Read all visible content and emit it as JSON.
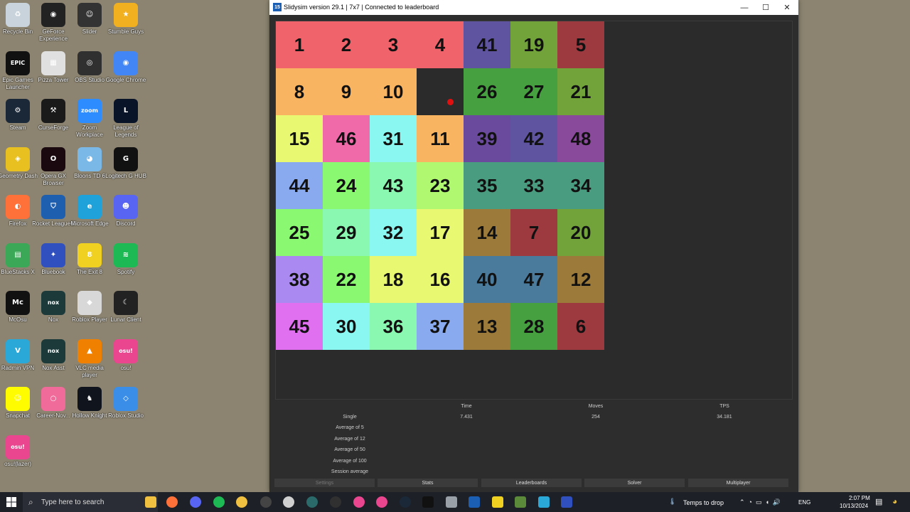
{
  "desktop": {
    "icons": [
      {
        "label": "Recycle Bin",
        "icon": "recycle-bin-icon",
        "color": "#c8d3dc",
        "glyph": "♻"
      },
      {
        "label": "GeForce Experience",
        "icon": "geforce-icon",
        "color": "#222222",
        "glyph": "◉"
      },
      {
        "label": "Slider",
        "icon": "slider-icon",
        "color": "#333333",
        "glyph": "☺"
      },
      {
        "label": "Stumble Guys",
        "icon": "stumble-guys-icon",
        "color": "#f0b020",
        "glyph": "★"
      },
      {
        "label": "Epic Games Launcher",
        "icon": "epic-games-icon",
        "color": "#111111",
        "glyph": "EPIC"
      },
      {
        "label": "Pizza Tower",
        "icon": "pizza-tower-icon",
        "color": "#e0e0e0",
        "glyph": "▦"
      },
      {
        "label": "OBS Studio",
        "icon": "obs-icon",
        "color": "#303030",
        "glyph": "◎"
      },
      {
        "label": "Google Chrome",
        "icon": "chrome-icon",
        "color": "#4285f4",
        "glyph": "◉"
      },
      {
        "label": "Steam",
        "icon": "steam-icon",
        "color": "#1b2838",
        "glyph": "⚙"
      },
      {
        "label": "CurseForge",
        "icon": "curseforge-icon",
        "color": "#1a1a1a",
        "glyph": "⚒"
      },
      {
        "label": "Zoom Workplace",
        "icon": "zoom-icon",
        "color": "#2d8cff",
        "glyph": "zoom"
      },
      {
        "label": "League of Legends",
        "icon": "league-icon",
        "color": "#0a1428",
        "glyph": "L"
      },
      {
        "label": "Geometry Dash",
        "icon": "geometry-dash-icon",
        "color": "#e8c020",
        "glyph": "◈"
      },
      {
        "label": "Opera GX Browser",
        "icon": "opera-gx-icon",
        "color": "#1a0a0f",
        "glyph": "O"
      },
      {
        "label": "Bloons TD 6",
        "icon": "bloons-icon",
        "color": "#7ab8e8",
        "glyph": "◕"
      },
      {
        "label": "Logitech G HUB",
        "icon": "logitech-icon",
        "color": "#111111",
        "glyph": "G"
      },
      {
        "label": "Firefox",
        "icon": "firefox-icon",
        "color": "#ff7139",
        "glyph": "◐"
      },
      {
        "label": "Rocket League®",
        "icon": "rocket-league-icon",
        "color": "#1e5fb0",
        "glyph": "⛉"
      },
      {
        "label": "Microsoft Edge",
        "icon": "edge-icon",
        "color": "#1fa1d9",
        "glyph": "e"
      },
      {
        "label": "Discord",
        "icon": "discord-icon",
        "color": "#5865f2",
        "glyph": "☻"
      },
      {
        "label": "BlueStacks X",
        "icon": "bluestacks-icon",
        "color": "#3aa856",
        "glyph": "▤"
      },
      {
        "label": "Bluebook",
        "icon": "bluebook-icon",
        "color": "#3050c0",
        "glyph": "✦"
      },
      {
        "label": "The Exit 8",
        "icon": "exit8-icon",
        "color": "#f0d020",
        "glyph": "8"
      },
      {
        "label": "Spotify",
        "icon": "spotify-icon",
        "color": "#1db954",
        "glyph": "≋"
      },
      {
        "label": "McOsu",
        "icon": "mcosu-icon",
        "color": "#111111",
        "glyph": "Mc"
      },
      {
        "label": "Nox",
        "icon": "nox-icon",
        "color": "#1c3a3a",
        "glyph": "nox"
      },
      {
        "label": "Roblox Player",
        "icon": "roblox-player-icon",
        "color": "#d8d8d8",
        "glyph": "◆"
      },
      {
        "label": "Lunar Client",
        "icon": "lunar-client-icon",
        "color": "#222222",
        "glyph": "☾"
      },
      {
        "label": "Radmin VPN",
        "icon": "radmin-vpn-icon",
        "color": "#2aa8d8",
        "glyph": "V"
      },
      {
        "label": "Nox Asst",
        "icon": "nox-asst-icon",
        "color": "#1c3a3a",
        "glyph": "nox"
      },
      {
        "label": "VLC media player",
        "icon": "vlc-icon",
        "color": "#f08000",
        "glyph": "▲"
      },
      {
        "label": "osu!",
        "icon": "osu-icon",
        "color": "#e9468f",
        "glyph": "osu!"
      },
      {
        "label": "Snapchat",
        "icon": "snapchat-icon",
        "color": "#fffc00",
        "glyph": "☺"
      },
      {
        "label": "Career-Nov...",
        "icon": "career-nova-icon",
        "color": "#f06a9a",
        "glyph": "○"
      },
      {
        "label": "Hollow Knight",
        "icon": "hollow-knight-icon",
        "color": "#10141c",
        "glyph": "♞"
      },
      {
        "label": "Roblox Studio",
        "icon": "roblox-studio-icon",
        "color": "#3a8ee8",
        "glyph": "◇"
      },
      {
        "label": "osu!(lazer)",
        "icon": "osu-lazer-icon",
        "color": "#e9468f",
        "glyph": "osu!"
      }
    ]
  },
  "window": {
    "title": "Slidysim version 29.1 | 7x7 | Connected to leaderboard",
    "app_icon": "15",
    "controls": {
      "minimize": "—",
      "maximize": "☐",
      "close": "✕"
    }
  },
  "board": {
    "size": 7,
    "tiles": [
      {
        "n": "1",
        "c": "#f0636a"
      },
      {
        "n": "2",
        "c": "#f0636a"
      },
      {
        "n": "3",
        "c": "#f0636a"
      },
      {
        "n": "4",
        "c": "#f0636a"
      },
      {
        "n": "41",
        "c": "#5e54a0"
      },
      {
        "n": "19",
        "c": "#72a23a"
      },
      {
        "n": "5",
        "c": "#9c3a40"
      },
      {
        "n": "8",
        "c": "#f8b460"
      },
      {
        "n": "9",
        "c": "#f8b460"
      },
      {
        "n": "10",
        "c": "#f8b460"
      },
      {
        "n": "",
        "c": "#2b2b2b"
      },
      {
        "n": "26",
        "c": "#46a040"
      },
      {
        "n": "27",
        "c": "#46a040"
      },
      {
        "n": "21",
        "c": "#72a23a"
      },
      {
        "n": "15",
        "c": "#e8f870"
      },
      {
        "n": "46",
        "c": "#f06aaa"
      },
      {
        "n": "31",
        "c": "#8af8f0"
      },
      {
        "n": "11",
        "c": "#f8b460"
      },
      {
        "n": "39",
        "c": "#6a4a9c"
      },
      {
        "n": "42",
        "c": "#5e54a0"
      },
      {
        "n": "48",
        "c": "#8a4a9c"
      },
      {
        "n": "44",
        "c": "#8aaaf0"
      },
      {
        "n": "24",
        "c": "#8af870"
      },
      {
        "n": "43",
        "c": "#8af8b0"
      },
      {
        "n": "23",
        "c": "#b0f870"
      },
      {
        "n": "35",
        "c": "#4a9c80"
      },
      {
        "n": "33",
        "c": "#4a9c80"
      },
      {
        "n": "34",
        "c": "#4a9c80"
      },
      {
        "n": "25",
        "c": "#8af870"
      },
      {
        "n": "29",
        "c": "#8af8b0"
      },
      {
        "n": "32",
        "c": "#8af8f0"
      },
      {
        "n": "17",
        "c": "#e8f870"
      },
      {
        "n": "14",
        "c": "#9c7a3a"
      },
      {
        "n": "7",
        "c": "#9c3a40"
      },
      {
        "n": "20",
        "c": "#72a23a"
      },
      {
        "n": "38",
        "c": "#aa8af0"
      },
      {
        "n": "22",
        "c": "#8af870"
      },
      {
        "n": "18",
        "c": "#e8f870"
      },
      {
        "n": "16",
        "c": "#e8f870"
      },
      {
        "n": "40",
        "c": "#4a7a9c"
      },
      {
        "n": "47",
        "c": "#4a7a9c"
      },
      {
        "n": "12",
        "c": "#9c7a3a"
      },
      {
        "n": "45",
        "c": "#e070f0"
      },
      {
        "n": "30",
        "c": "#8af8f0"
      },
      {
        "n": "36",
        "c": "#8af8b0"
      },
      {
        "n": "37",
        "c": "#8aaaf0"
      },
      {
        "n": "13",
        "c": "#9c7a3a"
      },
      {
        "n": "28",
        "c": "#46a040"
      },
      {
        "n": "6",
        "c": "#9c3a40"
      }
    ]
  },
  "stats": {
    "headers": {
      "time": "Time",
      "moves": "Moves",
      "tps": "TPS"
    },
    "rows": [
      {
        "label": "Single",
        "time": "7.431",
        "moves": "254",
        "tps": "34.181"
      },
      {
        "label": "Average of 5",
        "time": "",
        "moves": "",
        "tps": ""
      },
      {
        "label": "Average of 12",
        "time": "",
        "moves": "",
        "tps": ""
      },
      {
        "label": "Average of 50",
        "time": "",
        "moves": "",
        "tps": ""
      },
      {
        "label": "Average of 100",
        "time": "",
        "moves": "",
        "tps": ""
      },
      {
        "label": "Session average",
        "time": "",
        "moves": "",
        "tps": ""
      }
    ]
  },
  "buttons": {
    "settings": "Settings",
    "stats": "Stats",
    "leaderboards": "Leaderboards",
    "solver": "Solver",
    "multiplayer": "Multiplayer"
  },
  "taskbar": {
    "search_placeholder": "Type here to search",
    "apps": [
      {
        "icon": "file-explorer-icon",
        "color": "#f0c040"
      },
      {
        "icon": "firefox-icon",
        "color": "#ff7139"
      },
      {
        "icon": "discord-icon",
        "color": "#5865f2"
      },
      {
        "icon": "spotify-icon",
        "color": "#1db954"
      },
      {
        "icon": "folder-icon",
        "color": "#f0c040"
      },
      {
        "icon": "lunar-client-icon",
        "color": "#444444"
      },
      {
        "icon": "roblox-icon",
        "color": "#d0d0d0"
      },
      {
        "icon": "nox-icon",
        "color": "#2a6a6a"
      },
      {
        "icon": "obs-icon",
        "color": "#303030"
      },
      {
        "icon": "osu-icon",
        "color": "#e9468f"
      },
      {
        "icon": "osu-lazer-icon",
        "color": "#e9468f"
      },
      {
        "icon": "steam-icon",
        "color": "#1b2838"
      },
      {
        "icon": "epic-games-icon",
        "color": "#111111"
      },
      {
        "icon": "storage-icon",
        "color": "#9aa0a8"
      },
      {
        "icon": "slidysim-icon",
        "color": "#1a5fb4"
      },
      {
        "icon": "yellow-circle-icon",
        "color": "#f0d020"
      },
      {
        "icon": "minecraft-icon",
        "color": "#5a8a3a"
      },
      {
        "icon": "radmin-vpn-icon",
        "color": "#2aa8d8"
      },
      {
        "icon": "bluebook-icon",
        "color": "#3050c0"
      }
    ],
    "weather": "Temps to drop",
    "language": "ENG",
    "time": "2:07 PM",
    "date": "10/13/2024"
  }
}
